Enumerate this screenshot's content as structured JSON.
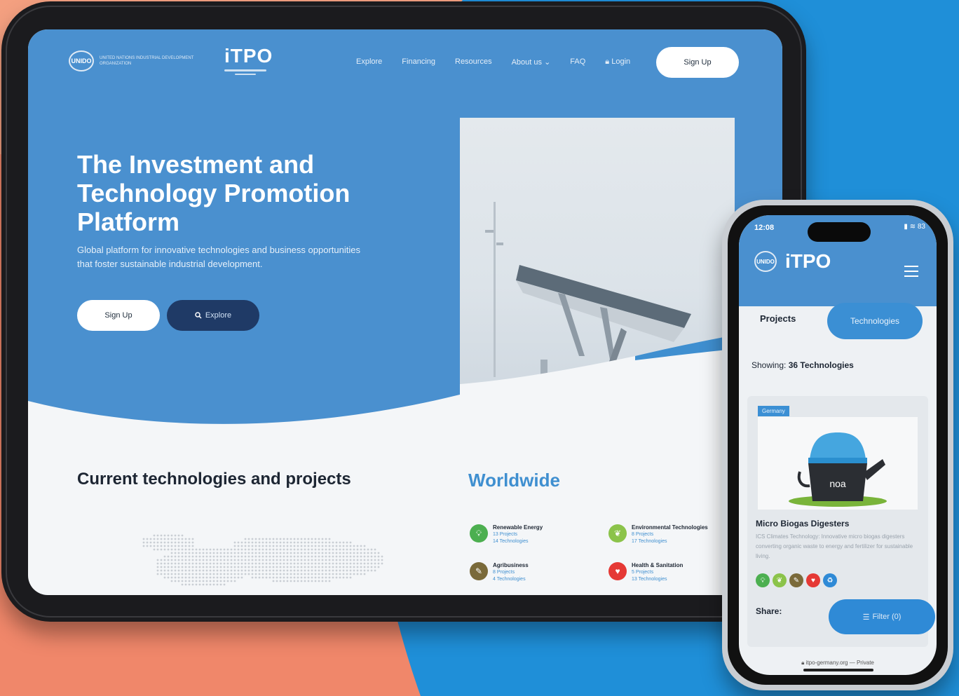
{
  "tablet": {
    "nav": {
      "org_name": "UNITED NATIONS INDUSTRIAL DEVELOPMENT ORGANIZATION",
      "unido_mark": "UNIDO",
      "brand": "iTPO",
      "links": [
        "Explore",
        "Financing",
        "Resources",
        "About us",
        "FAQ",
        "Login"
      ],
      "signup": "Sign Up"
    },
    "hero": {
      "title": "The Investment and Technology Promotion Platform",
      "subtitle": "Global platform for innovative technologies and business opportunities that foster sustainable industrial development.",
      "signup": "Sign Up",
      "explore": "Explore"
    },
    "sections": {
      "current": "Current technologies and projects",
      "worldwide": "Worldwide"
    },
    "categories": [
      {
        "name": "Renewable Energy",
        "projects": "13 Projects",
        "technologies": "14 Technologies",
        "color": "#4caf50",
        "icon": "lightbulb-icon"
      },
      {
        "name": "Environmental Technologies",
        "projects": "8 Projects",
        "technologies": "17 Technologies",
        "color": "#8bc34a",
        "icon": "leaf-icon"
      },
      {
        "name": "Agribusiness",
        "projects": "8 Projects",
        "technologies": "4 Technologies",
        "color": "#7a6a3a",
        "icon": "wheat-icon"
      },
      {
        "name": "Health & Sanitation",
        "projects": "5 Projects",
        "technologies": "13 Technologies",
        "color": "#e53935",
        "icon": "heart-icon"
      }
    ]
  },
  "phone": {
    "status": {
      "time": "12:08",
      "battery": "83"
    },
    "unido_mark": "UNIDO",
    "brand": "iTPO",
    "tabs": {
      "projects": "Projects",
      "technologies": "Technologies"
    },
    "showing_label": "Showing:",
    "showing_value": "36 Technologies",
    "card": {
      "country": "Germany",
      "title": "Micro Biogas Digesters",
      "description": "ICS Climates Technology: Innovative micro biogas digesters converting organic waste to energy and fertilizer for sustainable living.",
      "device_text": "noa"
    },
    "share": "Share:",
    "filter": "Filter (0)",
    "url": "itpo-germany.org",
    "url_suffix": "— Private"
  },
  "colors": {
    "hero_blue": "#4a90cf",
    "navy": "#1f3a66",
    "accent_blue": "#3b8fd4",
    "salmon": "#f0876a",
    "background_blue": "#1f8fd8"
  }
}
